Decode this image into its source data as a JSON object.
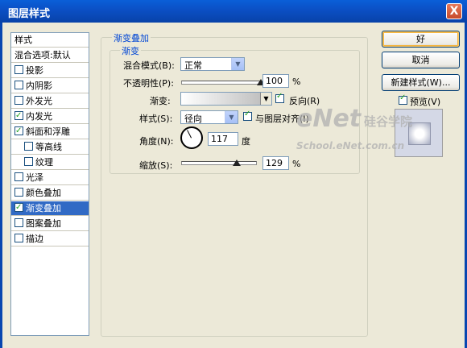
{
  "window": {
    "title": "图层样式",
    "close_label": "X"
  },
  "style_list": {
    "items": [
      {
        "label": "样式",
        "kind": "header"
      },
      {
        "label": "混合选项:默认",
        "kind": "header"
      },
      {
        "label": "投影",
        "checked": false
      },
      {
        "label": "内阴影",
        "checked": false
      },
      {
        "label": "外发光",
        "checked": false
      },
      {
        "label": "内发光",
        "checked": true
      },
      {
        "label": "斜面和浮雕",
        "checked": true
      },
      {
        "label": "等高线",
        "checked": false,
        "sub": true
      },
      {
        "label": "纹理",
        "checked": false,
        "sub": true
      },
      {
        "label": "光泽",
        "checked": false
      },
      {
        "label": "颜色叠加",
        "checked": false
      },
      {
        "label": "渐变叠加",
        "checked": true,
        "selected": true
      },
      {
        "label": "图案叠加",
        "checked": false
      },
      {
        "label": "描边",
        "checked": false
      }
    ]
  },
  "panel": {
    "outer_legend": "渐变叠加",
    "inner_legend": "渐变",
    "blend_mode_label": "混合模式(B):",
    "blend_mode_value": "正常",
    "opacity_label": "不透明性(P):",
    "opacity_value": "100",
    "opacity_percent": 100,
    "gradient_label": "渐变:",
    "reverse_label": "反向(R)",
    "reverse_checked": true,
    "style_label": "样式(S):",
    "style_value": "径向",
    "align_label": "与图层对齐(I)",
    "align_checked": true,
    "angle_label": "角度(N):",
    "angle_value": "117",
    "angle_unit": "度",
    "scale_label": "缩放(S):",
    "scale_value": "129",
    "scale_percent": 129,
    "percent_unit": "%"
  },
  "buttons": {
    "ok": "好",
    "cancel": "取消",
    "new_style": "新建样式(W)...",
    "preview_label": "预览(V)",
    "preview_checked": true
  },
  "watermark": {
    "line1": "eNet",
    "line2": "硅谷学院",
    "line3": "School.eNet.com.cn"
  }
}
